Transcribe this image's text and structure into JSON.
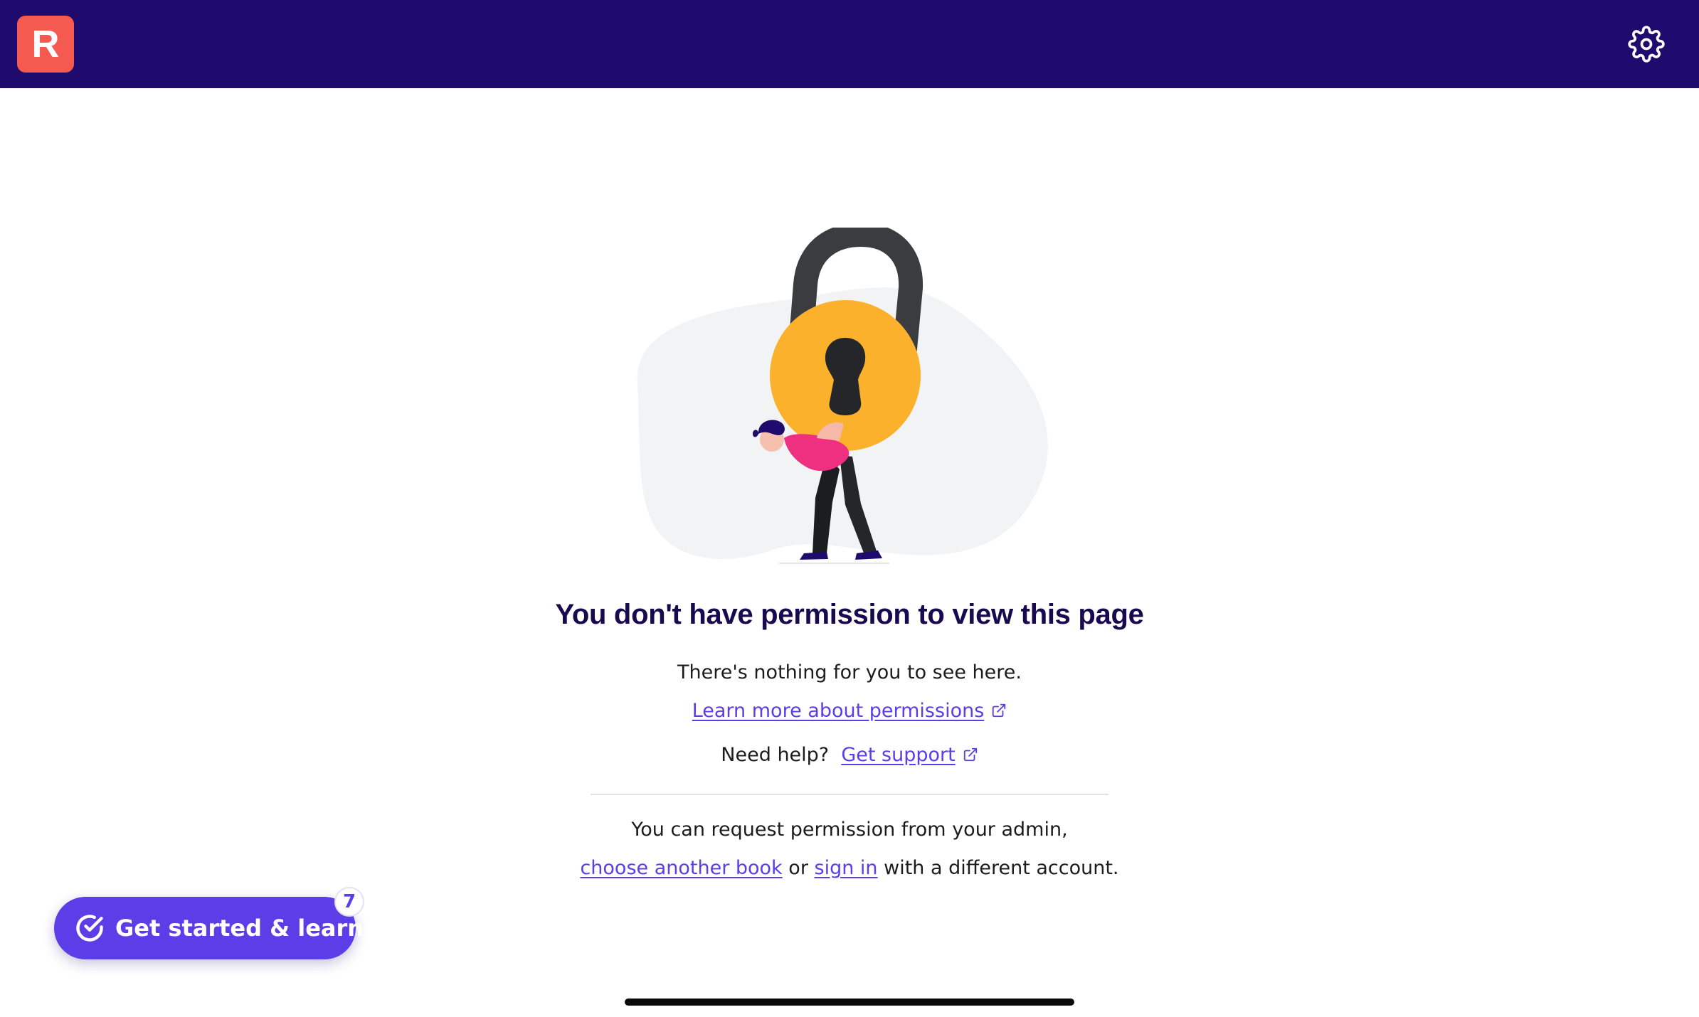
{
  "header": {
    "logo_letter": "R",
    "settings_icon": "gear-icon"
  },
  "main": {
    "title": "You don't have permission to view this page",
    "subtitle": "There's nothing for you to see here.",
    "learn_more_link": "Learn more about permissions",
    "help_prefix": "Need help?",
    "support_link": "Get support",
    "request_text": "You can request permission from your admin,",
    "choose_book_link": "choose another book",
    "or_text": "or",
    "sign_in_link": "sign in",
    "different_account_text": "with a different account."
  },
  "cta": {
    "label": "Get started & learn",
    "badge_count": "7",
    "icon": "check-circle-icon"
  },
  "colors": {
    "header_bg": "#1f0a6e",
    "logo_bg": "#f45a4f",
    "accent": "#5b3ee8",
    "title": "#170a4f",
    "lock_body": "#fbb12b"
  }
}
